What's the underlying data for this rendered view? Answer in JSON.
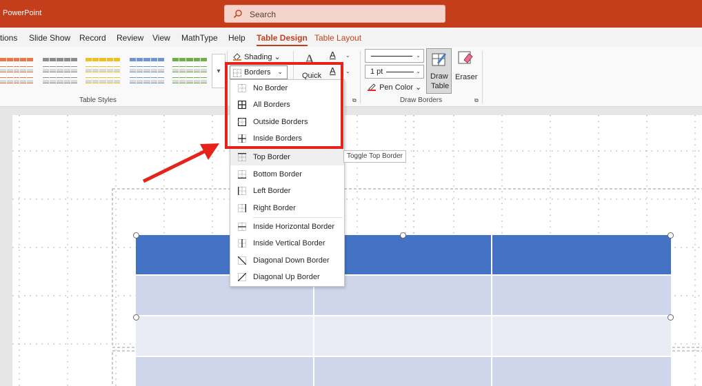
{
  "app": {
    "title": "PowerPoint"
  },
  "search": {
    "label": "Search"
  },
  "menu": {
    "tabs": [
      "tions",
      "Slide Show",
      "Record",
      "Review",
      "View",
      "MathType",
      "Help",
      "Table Design",
      "Table Layout"
    ],
    "active_tab": "Table Design"
  },
  "ribbon": {
    "table_styles": {
      "label": "Table Styles",
      "swatch_colors": [
        "#e8774a",
        "#8c8c8c",
        "#f0c020",
        "#6f94d1",
        "#70ad47"
      ]
    },
    "shading_label": "Shading",
    "borders_label": "Borders",
    "quick_label": "Quick",
    "pen_weight": "1 pt",
    "pen_color_label": "Pen Color",
    "draw_table_label": [
      "Draw",
      "Table"
    ],
    "eraser_label": "Eraser",
    "draw_borders_label": "Draw Borders"
  },
  "borders_menu": {
    "items": [
      {
        "label": "No Border",
        "icon": "no-border-icon"
      },
      {
        "label": "All Borders",
        "icon": "all-borders-icon"
      },
      {
        "label": "Outside Borders",
        "icon": "outside-borders-icon"
      },
      {
        "label": "Inside Borders",
        "icon": "inside-borders-icon"
      },
      {
        "label": "Top Border",
        "icon": "top-border-icon"
      },
      {
        "label": "Bottom Border",
        "icon": "bottom-border-icon"
      },
      {
        "label": "Left Border",
        "icon": "left-border-icon"
      },
      {
        "label": "Right Border",
        "icon": "right-border-icon"
      },
      {
        "label": "Inside Horizontal Border",
        "icon": "inside-horizontal-border-icon"
      },
      {
        "label": "Inside Vertical Border",
        "icon": "inside-vertical-border-icon"
      },
      {
        "label": "Diagonal Down Border",
        "icon": "diagonal-down-border-icon"
      },
      {
        "label": "Diagonal Up Border",
        "icon": "diagonal-up-border-icon"
      }
    ],
    "hovered_item": "Top Border"
  },
  "tooltip": {
    "text": "Toggle Top Border"
  },
  "annotation": {
    "highlight_color": "#e5231b"
  },
  "table": {
    "header_color": "#4472c4",
    "band_color_1": "#cfd5ea",
    "band_color_2": "#e9ebf5"
  }
}
